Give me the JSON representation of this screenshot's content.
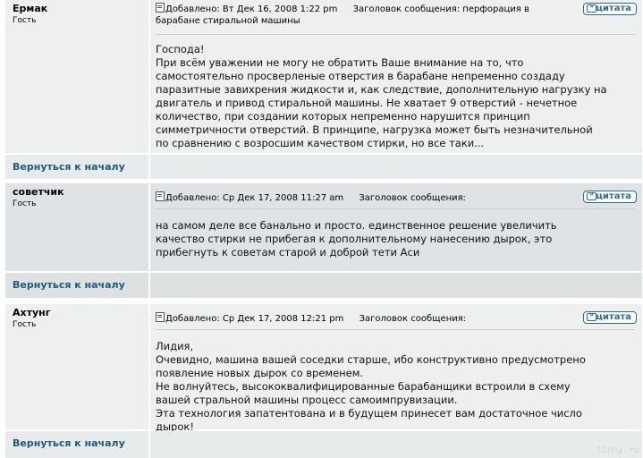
{
  "posts": [
    {
      "username": "Ермак",
      "rank": "Гость",
      "posted_label": "Добавлено:",
      "posted_at": "Вт Дек 16, 2008 1:22 pm",
      "subject_label": "Заголовок сообщения:",
      "subject": "перфорация в барабане стиральной машины",
      "quote_label": "цитата",
      "quote_icon": "quote-icon",
      "lines": [
        "Господа!",
        "При всём уважении не могу не обратить Ваше внимание на то, что",
        "самостоятельно просверленые отверстия в барабане непременно создаду",
        "паразитные завихрения жидкости и, как следствие, дополнительную нагрузку на",
        "двигатель и привод стиральной машины. Не хватает 9 отверстий - нечетное",
        "количество, при создании которых непременно нарушится принцип",
        "симметричности отверстий. В принципе, нагрузка может быть незначительной",
        "по сравнению с возросшим качеством стирки, но все таки..."
      ],
      "back_link": "Вернуться к началу"
    },
    {
      "username": "советчик",
      "rank": "Гость",
      "posted_label": "Добавлено:",
      "posted_at": "Ср Дек 17, 2008 11:27 am",
      "subject_label": "Заголовок сообщения:",
      "subject": "",
      "quote_label": "цитата",
      "quote_icon": "quote-icon",
      "lines": [
        "на самом деле все банально и просто. единственное решение увеличить",
        "качество стирки не прибегая к дополнительному нанесению дырок, это",
        "прибегнуть к советам старой и доброй тети Аси"
      ],
      "back_link": "Вернуться к началу"
    },
    {
      "username": "Ахтунг",
      "rank": "Гость",
      "posted_label": "Добавлено:",
      "posted_at": "Ср Дек 17, 2008 12:21 pm",
      "subject_label": "Заголовок сообщения:",
      "subject": "",
      "quote_label": "цитата",
      "quote_icon": "quote-icon",
      "lines": [
        "Лидия,",
        "Очевидно, машина вашей соседки старше, ибо конструктивно предусмотрено",
        "появление новых дырок со временем.",
        "Не волнуйтесь, высококвалифицированные барабанщики встроили в схему",
        "вашей стральной машины процесс самоимпрувизации.",
        "Эта технология запатентована и в будущем принесет вам достаточное число",
        "дырок!"
      ],
      "back_link": "Вернуться к началу"
    }
  ],
  "watermark": "tinny.ru",
  "colors": {
    "row": "#eef0f0",
    "row_alt": "#dfe3e5",
    "link": "#1f5a7a",
    "quote_button": "#2d6a8c"
  }
}
